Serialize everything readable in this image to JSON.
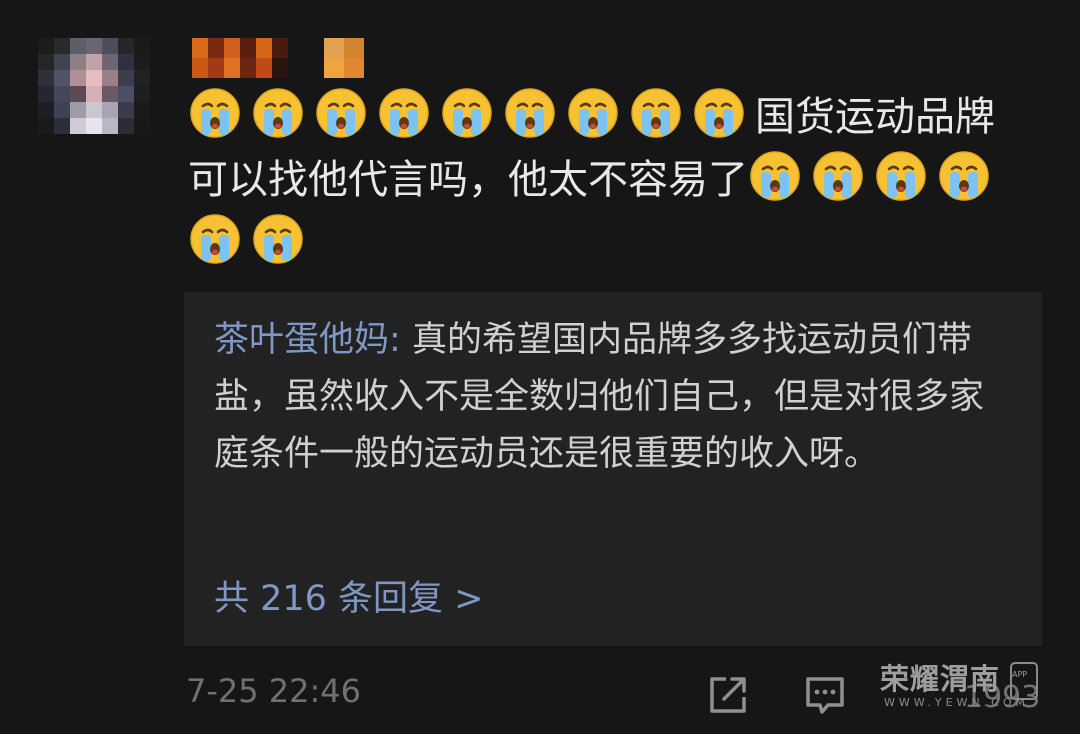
{
  "comment": {
    "text": "国货运动品牌可以找他代言吗，他太不容易了",
    "emoji_icon": "crying-face-icon",
    "emoji_before_text": 9,
    "emoji_after_text": 6
  },
  "reply_preview": {
    "author": "茶叶蛋他妈",
    "separator": ": ",
    "text": "真的希望国内品牌多多找运动员们带盐，虽然收入不是全数归他们自己，但是对很多家庭条件一般的运动员还是很重要的收入呀。",
    "more_link": "共 216 条回复 >"
  },
  "meta": {
    "timestamp": "7-25 22:46"
  },
  "actions": {
    "share_icon": "share-icon",
    "comment_icon": "comment-icon"
  },
  "watermark": {
    "title": "荣耀渭南",
    "url": "WWW.YEWN.COM",
    "count": "1993",
    "badge": "APP"
  },
  "colors": {
    "background": "#161616",
    "reply_background": "#222222",
    "link": "#7f97c4",
    "timestamp": "#707070"
  }
}
